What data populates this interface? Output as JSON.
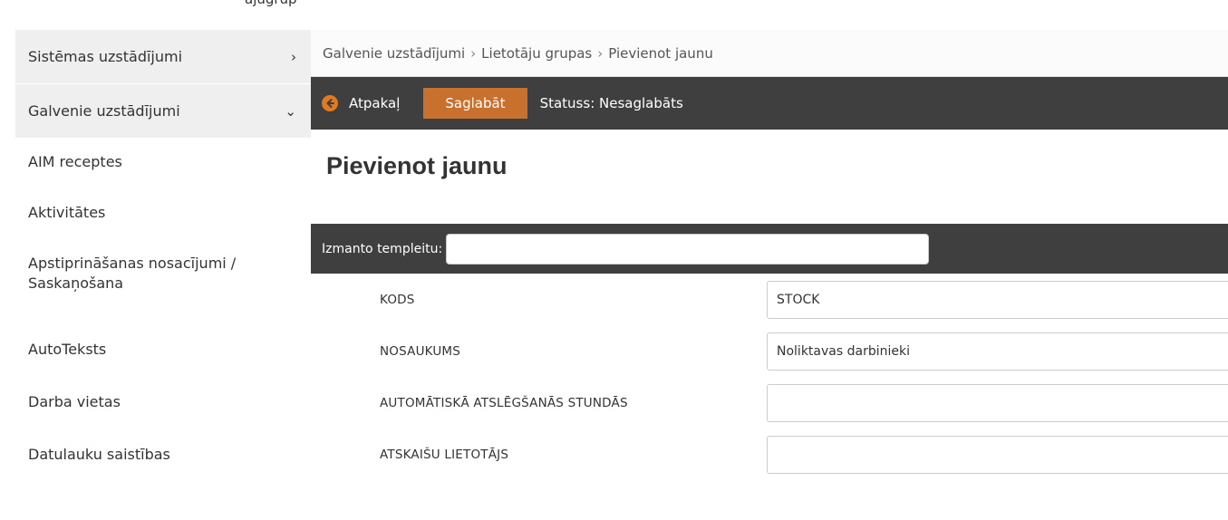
{
  "top_partial_text": "ājugrup",
  "sidebar": {
    "section1": {
      "label": "Sistēmas uzstādījumi",
      "chevron": "›"
    },
    "section2": {
      "label": "Galvenie uzstādījumi",
      "chevron": "⌄"
    },
    "items": [
      {
        "label": "AIM receptes"
      },
      {
        "label": "Aktivitātes"
      },
      {
        "label": "Apstiprināšanas nosacījumi / Saskaņošana"
      },
      {
        "label": "AutoTeksts"
      },
      {
        "label": "Darba vietas"
      },
      {
        "label": "Datulauku saistības"
      }
    ]
  },
  "breadcrumb": {
    "items": [
      "Galvenie uzstādījumi",
      "Lietotāju grupas",
      "Pievienot jaunu"
    ],
    "separator": "›"
  },
  "toolbar": {
    "back_label": "Atpakaļ",
    "save_label": "Saglabāt",
    "status_text": "Statuss: Nesaglabāts",
    "accent_color": "#c8702e",
    "bar_color": "#3f3f3f"
  },
  "page_title": "Pievienot jaunu",
  "template": {
    "label": "Izmanto templeitu:",
    "value": ""
  },
  "form": {
    "fields": [
      {
        "label": "KODS",
        "value": "STOCK"
      },
      {
        "label": "NOSAUKUMS",
        "value": "Noliktavas darbinieki"
      },
      {
        "label": "AUTOMĀTISKĀ ATSLĒGŠANĀS STUNDĀS",
        "value": ""
      },
      {
        "label": "ATSKAIŠU LIETOTĀJS",
        "value": ""
      }
    ]
  }
}
